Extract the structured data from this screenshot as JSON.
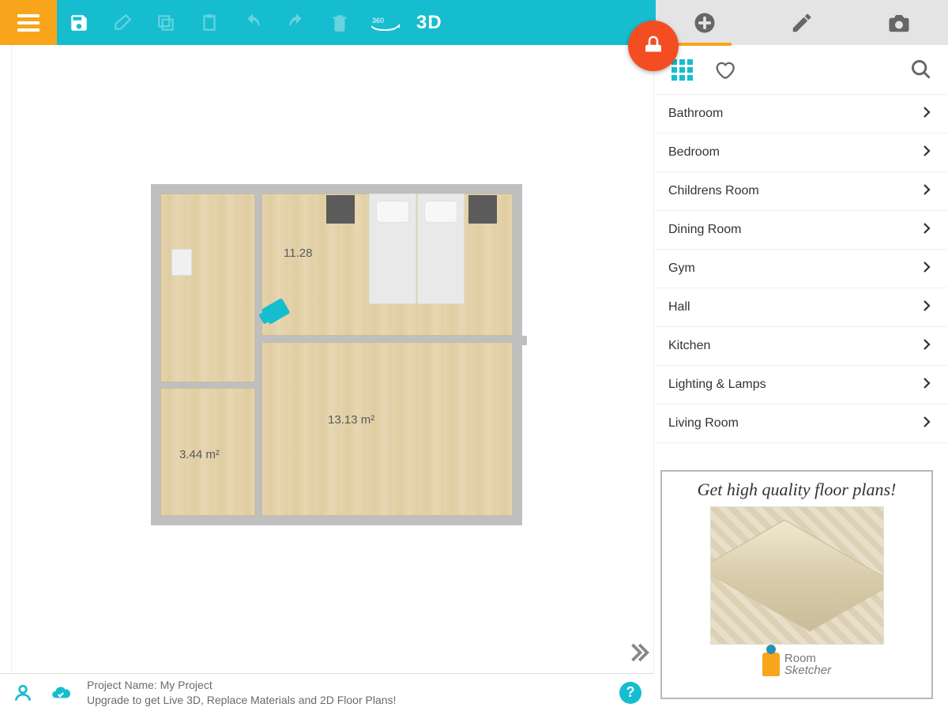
{
  "toolbar": {
    "view3d_label": "3D"
  },
  "sidebar": {
    "categories": [
      {
        "label": "Bathroom"
      },
      {
        "label": "Bedroom"
      },
      {
        "label": "Childrens Room"
      },
      {
        "label": "Dining Room"
      },
      {
        "label": "Gym"
      },
      {
        "label": "Hall"
      },
      {
        "label": "Kitchen"
      },
      {
        "label": "Lighting & Lamps"
      },
      {
        "label": "Living Room"
      }
    ]
  },
  "floorplan": {
    "rooms": {
      "bedroom_area": "11.28",
      "large_area": "13.13 m²",
      "small_area": "3.44 m²"
    }
  },
  "promo": {
    "headline": "Get high quality floor plans!",
    "brand_line1": "Room",
    "brand_line2": "Sketcher"
  },
  "status": {
    "project_label": "Project Name:",
    "project_name": "My Project",
    "upgrade_msg": "Upgrade to get Live 3D, Replace Materials and 2D Floor Plans!",
    "help_glyph": "?"
  }
}
